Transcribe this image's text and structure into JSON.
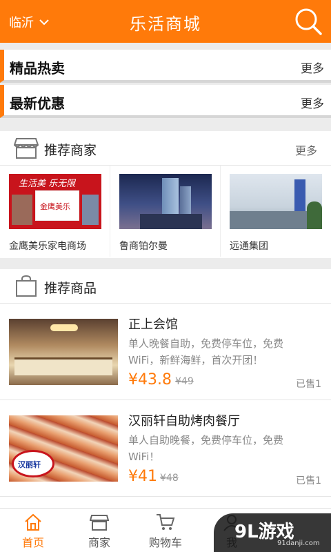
{
  "header": {
    "city": "临沂",
    "title": "乐活商城"
  },
  "sections": {
    "hot": "精品热卖",
    "latest": "最新优惠",
    "more": "更多"
  },
  "merchants": {
    "title": "推荐商家",
    "more": "更多",
    "items": [
      {
        "name": "金鹰美乐家电商场",
        "banner_line": "生活美 乐无限",
        "logo_text": "金鹰美乐"
      },
      {
        "name": "鲁商铂尔曼"
      },
      {
        "name": "远通集团"
      }
    ]
  },
  "products": {
    "title": "推荐商品",
    "items": [
      {
        "name": "正上会馆",
        "desc": "单人晚餐自助，免费停车位，免费WiFi，新鲜海鲜，首次开团！",
        "price": "¥43.8",
        "old_price": "¥49",
        "sold": "已售1"
      },
      {
        "name": "汉丽轩自助烤肉餐厅",
        "desc": "单人自助晚餐，免费停车位，免费WiFi！",
        "price": "¥41",
        "old_price": "¥48",
        "sold": "已售1",
        "logo_text": "汉丽轩"
      }
    ]
  },
  "tabs": [
    {
      "label": "首页",
      "icon": "home-icon",
      "active": true
    },
    {
      "label": "商家",
      "icon": "shop-icon"
    },
    {
      "label": "购物车",
      "icon": "cart-icon"
    },
    {
      "label": "我",
      "icon": "user-icon"
    }
  ],
  "watermark": {
    "brand": "9L游戏",
    "site": "91danji.com"
  },
  "colors": {
    "accent": "#ff7a0a"
  }
}
